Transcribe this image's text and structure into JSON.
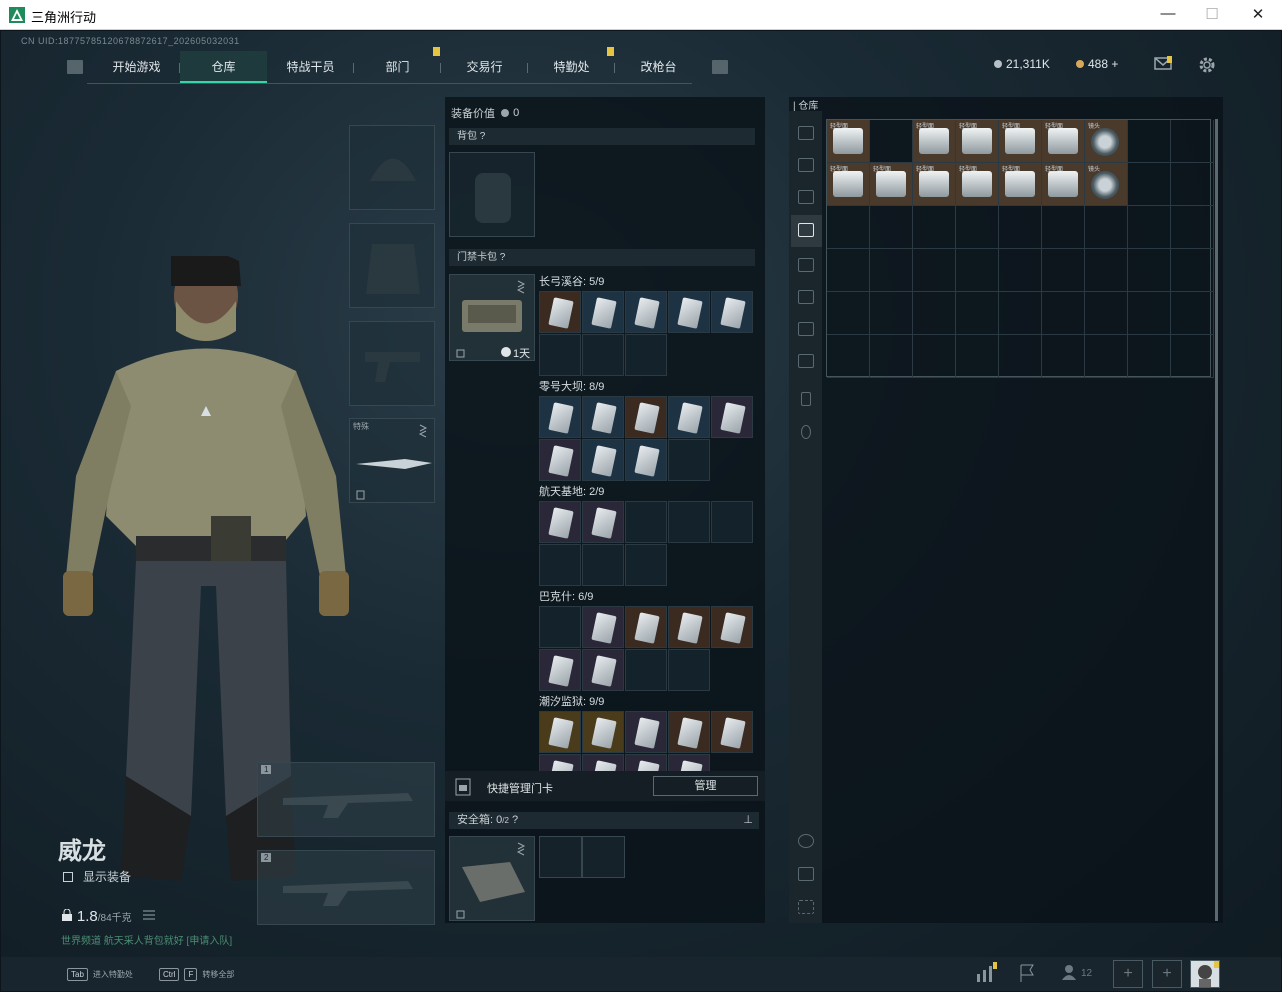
{
  "window": {
    "title": "三角洲行动",
    "minimize": "—",
    "maximize": "☐",
    "close": "✕"
  },
  "uid": "CN UID:18775785120678872617_202605032031",
  "nav": {
    "tabs": [
      {
        "label": "开始游戏",
        "badge": false
      },
      {
        "label": "仓库",
        "badge": false,
        "active": true
      },
      {
        "label": "特战干员",
        "badge": false
      },
      {
        "label": "部门",
        "badge": true
      },
      {
        "label": "交易行",
        "badge": false
      },
      {
        "label": "特勤处",
        "badge": true
      },
      {
        "label": "改枪台",
        "badge": false
      }
    ]
  },
  "currency": {
    "silver": "21,311K",
    "gold": "488",
    "gold_add": "+"
  },
  "character": {
    "name": "威龙",
    "show_equip": "显示装备",
    "weight_value": "1.8",
    "weight_unit": "/84千克",
    "tip": "世界频道 航天采人背包就好 [申请入队]"
  },
  "equip_slots": {
    "melee_label": "特殊",
    "weapon1": "1",
    "weapon2": "2"
  },
  "mid": {
    "equip_value_label": "装备价值",
    "equip_value": "0",
    "backpack_label": "背包",
    "keycard_label": "门禁卡包",
    "keycard_timer": "1天",
    "groups": [
      {
        "title": "长弓溪谷: 5/9"
      },
      {
        "title": "零号大坝: 8/9"
      },
      {
        "title": "航天基地: 2/9"
      },
      {
        "title": "巴克什: 6/9"
      },
      {
        "title": "潮汐监狱: 9/9"
      }
    ],
    "quick_manage": "快捷管理门卡",
    "manage_btn": "管理",
    "safebox_label": "安全箱:",
    "safebox_count": "0",
    "safebox_cap": "/2"
  },
  "warehouse": {
    "title": "仓库",
    "items_row1": [
      "轻型面",
      "",
      "轻型面",
      "轻型面",
      "轻型面",
      "轻型面",
      "镜头"
    ],
    "items_row2": [
      "轻型面",
      "轻型面",
      "轻型面",
      "轻型面",
      "轻型面",
      "轻型面",
      "镜头"
    ]
  },
  "bottom": {
    "tab_key": "Tab",
    "tab_label": "进入特勤处",
    "ctrl_key": "Ctrl",
    "f_key": "F",
    "ctrl_label": "转移全部",
    "friends": "12"
  },
  "colors": {
    "accent": "#35d6a6",
    "badge": "#e5c443"
  },
  "icons": [
    "arrow-swap-icon",
    "lock-icon",
    "clock-icon",
    "gear-icon",
    "mail-icon",
    "list-icon",
    "pin-icon"
  ]
}
